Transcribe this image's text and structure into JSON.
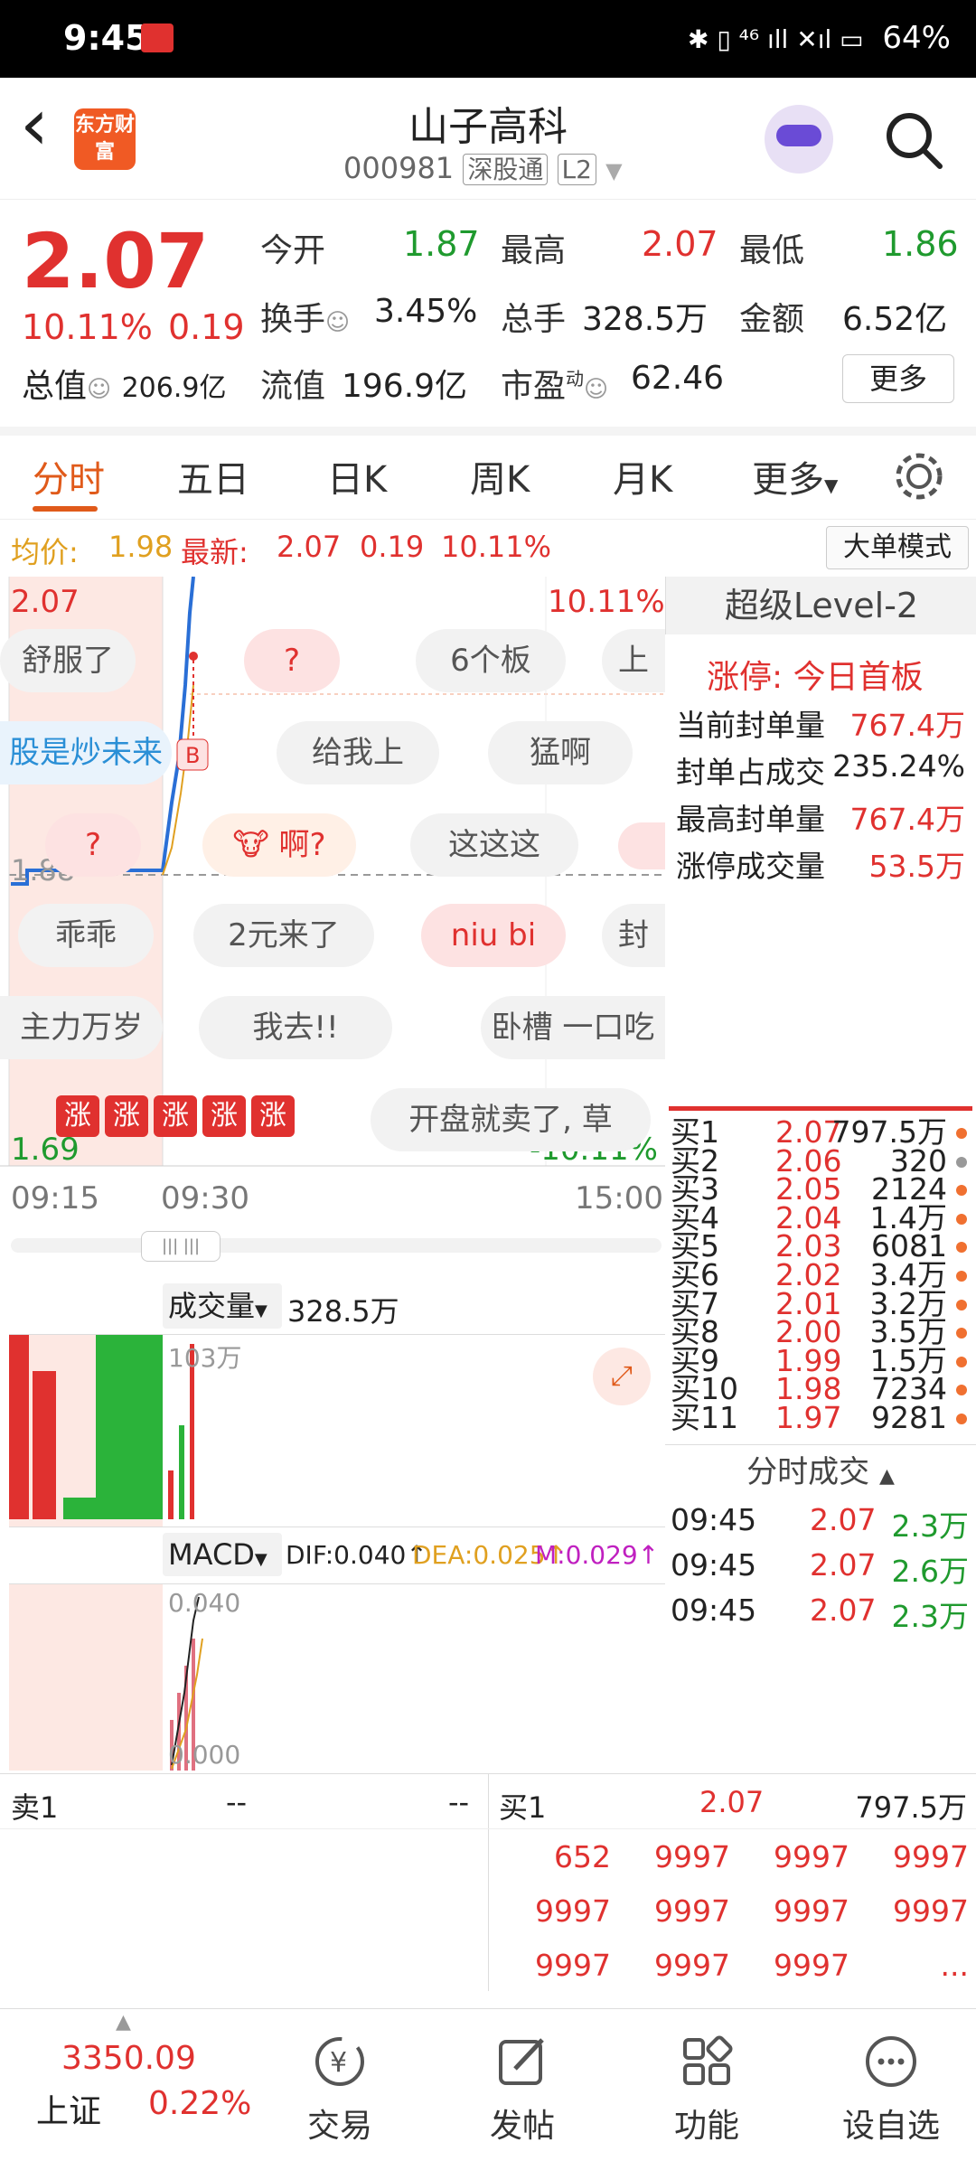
{
  "status": {
    "time": "9:45",
    "battery": "64%",
    "signal": "✱ ▯ ⁴⁶ ıll ✕ıl ▭"
  },
  "header": {
    "back": "‹",
    "logo": "东方财富",
    "name": "山子高科",
    "code": "000981",
    "tag1": "深股通",
    "tag2": "L2"
  },
  "quote": {
    "price": "2.07",
    "pct": "10.11%",
    "chg": "0.19",
    "open_label": "今开",
    "open": "1.87",
    "high_label": "最高",
    "high": "2.07",
    "low_label": "最低",
    "low": "1.86",
    "turnover_label": "换手",
    "turnover": "3.45%",
    "volume_label": "总手",
    "volume": "328.5万",
    "amount_label": "金额",
    "amount": "6.52亿",
    "mktcap_label": "总值",
    "mktcap": "206.9亿",
    "float_label": "流值",
    "float": "196.9亿",
    "pe_label": "市盈",
    "pe_sup": "动",
    "pe": "62.46",
    "more": "更多"
  },
  "tabs": [
    "分时",
    "五日",
    "日K",
    "周K",
    "月K",
    "更多"
  ],
  "infoline": {
    "avg_label": "均价:",
    "avg": "1.98",
    "latest_label": "最新:",
    "latest": "2.07",
    "chg": "0.19",
    "pct": "10.11%",
    "dadan": "大单模式"
  },
  "chart": {
    "top_price": "2.07",
    "top_pct": "10.11%",
    "mid_price": "1.88",
    "bot_price": "1.69",
    "bot_pct": "-10.11%",
    "time_start": "09:15",
    "time_mid": "09:30",
    "time_end": "15:00",
    "vol_label": "成交量",
    "vol_value": "328.5万",
    "vol_max": "103万",
    "macd_label": "MACD",
    "dif": "DIF:0.040↑",
    "dea": "DEA:0.025↑",
    "m": "M:0.029↑",
    "macd_top": "0.040",
    "macd_bot": "0.000",
    "zhang": "涨"
  },
  "bullets": [
    {
      "text": "舒服了",
      "pink": false
    },
    {
      "text": "?",
      "pink": true
    },
    {
      "text": "6个板",
      "pink": false
    },
    {
      "text": "上",
      "pink": false
    },
    {
      "text": "股是炒未来",
      "pink": false
    },
    {
      "text": "给我上",
      "pink": false
    },
    {
      "text": "猛啊",
      "pink": false
    },
    {
      "text": "?",
      "pink": true
    },
    {
      "text": "啊?",
      "pink": true
    },
    {
      "text": "这这这",
      "pink": false
    },
    {
      "text": "乖乖",
      "pink": false
    },
    {
      "text": "2元来了",
      "pink": false
    },
    {
      "text": "niu bi",
      "pink": true
    },
    {
      "text": "封",
      "pink": false
    },
    {
      "text": "主力万岁",
      "pink": false
    },
    {
      "text": "我去!!",
      "pink": false
    },
    {
      "text": "卧槽 一口吃",
      "pink": false
    },
    {
      "text": "开盘就卖了, 草",
      "pink": false
    }
  ],
  "level2": {
    "title": "超级Level-2",
    "limit": "涨停: 今日首板",
    "rows": [
      {
        "label": "当前封单量",
        "value": "767.4万"
      },
      {
        "label": "封单占成交",
        "value": "235.24%"
      },
      {
        "label": "最高封单量",
        "value": "767.4万"
      },
      {
        "label": "涨停成交量",
        "value": "53.5万"
      }
    ]
  },
  "orderbook": [
    {
      "label": "买1",
      "price": "2.07",
      "vol": "797.5万",
      "dot": "#f07030"
    },
    {
      "label": "买2",
      "price": "2.06",
      "vol": "320",
      "dot": "#999999"
    },
    {
      "label": "买3",
      "price": "2.05",
      "vol": "2124",
      "dot": "#f07030"
    },
    {
      "label": "买4",
      "price": "2.04",
      "vol": "1.4万",
      "dot": "#f07030"
    },
    {
      "label": "买5",
      "price": "2.03",
      "vol": "6081",
      "dot": "#f07030"
    },
    {
      "label": "买6",
      "price": "2.02",
      "vol": "3.4万",
      "dot": "#f07030"
    },
    {
      "label": "买7",
      "price": "2.01",
      "vol": "3.2万",
      "dot": "#f07030"
    },
    {
      "label": "买8",
      "price": "2.00",
      "vol": "3.5万",
      "dot": "#f07030"
    },
    {
      "label": "买9",
      "price": "1.99",
      "vol": "1.5万",
      "dot": "#f07030"
    },
    {
      "label": "买10",
      "price": "1.98",
      "vol": "7234",
      "dot": "#f07030"
    },
    {
      "label": "买11",
      "price": "1.97",
      "vol": "9281",
      "dot": "#f07030"
    }
  ],
  "ticks": {
    "title": "分时成交",
    "rows": [
      {
        "time": "09:45",
        "price": "2.07",
        "vol": "2.3万"
      },
      {
        "time": "09:45",
        "price": "2.07",
        "vol": "2.6万"
      },
      {
        "time": "09:45",
        "price": "2.07",
        "vol": "2.3万"
      }
    ]
  },
  "queue": {
    "sell_label": "卖1",
    "sell_price": "--",
    "sell_vol": "--",
    "buy_label": "买1",
    "buy_price": "2.07",
    "buy_vol": "797.5万",
    "rows": [
      [
        "652",
        "9997",
        "9997",
        "9997"
      ],
      [
        "9997",
        "9997",
        "9997",
        "9997"
      ],
      [
        "9997",
        "9997",
        "9997",
        "..."
      ]
    ]
  },
  "nav": {
    "index_value": "3350.09",
    "index_name": "上证",
    "index_pct": "0.22%",
    "items": [
      "交易",
      "发帖",
      "功能",
      "设自选"
    ]
  }
}
